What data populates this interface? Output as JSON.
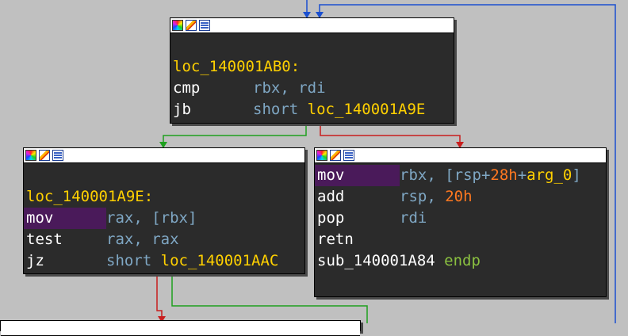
{
  "graph": {
    "nodes": [
      {
        "id": "loc_140001AB0",
        "label": "loc_140001AB0:",
        "lines": [
          {
            "mnemonic": "cmp",
            "operands": "rbx, rdi"
          },
          {
            "mnemonic": "jb",
            "operand_prefix": "short",
            "operand_label": "loc_140001A9E"
          }
        ]
      },
      {
        "id": "loc_140001A9E",
        "label": "loc_140001A9E:",
        "lines": [
          {
            "mnemonic": "mov",
            "operands": "rax, [rbx]"
          },
          {
            "mnemonic": "test",
            "operands": "rax, rax"
          },
          {
            "mnemonic": "jz",
            "operand_prefix": "short",
            "operand_label": "loc_140001AAC"
          }
        ]
      },
      {
        "id": "sub_140001A84_epilogue",
        "lines": [
          {
            "mnemonic": "mov",
            "operand_parts": [
              "rbx, [rsp+",
              "28h",
              "+",
              "arg_0",
              "]"
            ]
          },
          {
            "mnemonic": "add",
            "operand_parts": [
              "rsp, ",
              "20h"
            ]
          },
          {
            "mnemonic": "pop",
            "operands": "rdi"
          },
          {
            "mnemonic": "retn",
            "operands": ""
          },
          {
            "proc_name": "sub_140001A84",
            "directive": "endp"
          }
        ]
      }
    ],
    "edge_colors": {
      "taken": "#1fa01f",
      "not_taken": "#c81e1e",
      "back": "#1a4fd0"
    },
    "colors": {
      "canvas": "#c0c0c0",
      "node_bg": "#2b2b2b",
      "label": "#ffd000",
      "register": "#7fa7c4",
      "number": "#ff7820",
      "directive": "#8ac040",
      "highlight": "#4a1a5a"
    },
    "header_icons": [
      "color-palette-icon",
      "edit-node-icon",
      "graph-overview-icon"
    ]
  }
}
